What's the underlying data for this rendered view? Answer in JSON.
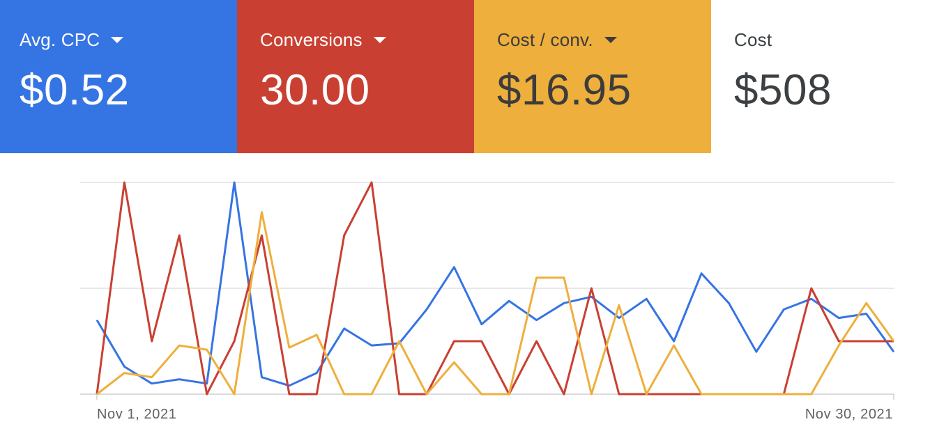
{
  "cards": [
    {
      "label": "Avg. CPC",
      "value": "$0.52",
      "bg": "#3574e3",
      "fg": "#ffffff",
      "dropdown": true
    },
    {
      "label": "Conversions",
      "value": "30.00",
      "bg": "#c94032",
      "fg": "#ffffff",
      "dropdown": true
    },
    {
      "label": "Cost / conv.",
      "value": "$16.95",
      "bg": "#eeaf3c",
      "fg": "#3c3c3c",
      "dropdown": true
    },
    {
      "label": "Cost",
      "value": "$508",
      "bg": "#ffffff",
      "fg": "#3c4043",
      "dropdown": false
    }
  ],
  "chart_data": {
    "type": "line",
    "x_start_label": "Nov 1, 2021",
    "x_end_label": "Nov 30, 2021",
    "x": [
      "2021-11-01",
      "2021-11-02",
      "2021-11-03",
      "2021-11-04",
      "2021-11-05",
      "2021-11-06",
      "2021-11-07",
      "2021-11-08",
      "2021-11-09",
      "2021-11-10",
      "2021-11-11",
      "2021-11-12",
      "2021-11-13",
      "2021-11-14",
      "2021-11-15",
      "2021-11-16",
      "2021-11-17",
      "2021-11-18",
      "2021-11-19",
      "2021-11-20",
      "2021-11-21",
      "2021-11-22",
      "2021-11-23",
      "2021-11-24",
      "2021-11-25",
      "2021-11-26",
      "2021-11-27",
      "2021-11-28",
      "2021-11-29",
      "2021-11-30"
    ],
    "grid": true,
    "series": [
      {
        "color": "#3574e3",
        "values": [
          0.35,
          0.13,
          0.05,
          0.07,
          0.05,
          1.0,
          0.08,
          0.04,
          0.1,
          0.31,
          0.23,
          0.24,
          0.4,
          0.6,
          0.33,
          0.44,
          0.35,
          0.43,
          0.46,
          0.36,
          0.45,
          0.25,
          0.57,
          0.43,
          0.2,
          0.4,
          0.45,
          0.36,
          0.38,
          0.2
        ]
      },
      {
        "color": "#c94032",
        "values": [
          0.0,
          1.0,
          0.25,
          0.75,
          0.0,
          0.25,
          0.75,
          0.0,
          0.0,
          0.75,
          1.0,
          0.0,
          0.0,
          0.25,
          0.25,
          0.0,
          0.25,
          0.0,
          0.5,
          0.0,
          0.0,
          0.0,
          0.0,
          0.0,
          0.0,
          0.0,
          0.5,
          0.25,
          0.25,
          0.25
        ]
      },
      {
        "color": "#eeaf3c",
        "values": [
          0.0,
          0.1,
          0.08,
          0.23,
          0.21,
          0.0,
          0.86,
          0.22,
          0.28,
          0.0,
          0.0,
          0.25,
          0.0,
          0.15,
          0.0,
          0.0,
          0.55,
          0.55,
          0.0,
          0.42,
          0.0,
          0.23,
          0.0,
          0.0,
          0.0,
          0.0,
          0.0,
          0.23,
          0.43,
          0.25
        ]
      }
    ]
  }
}
